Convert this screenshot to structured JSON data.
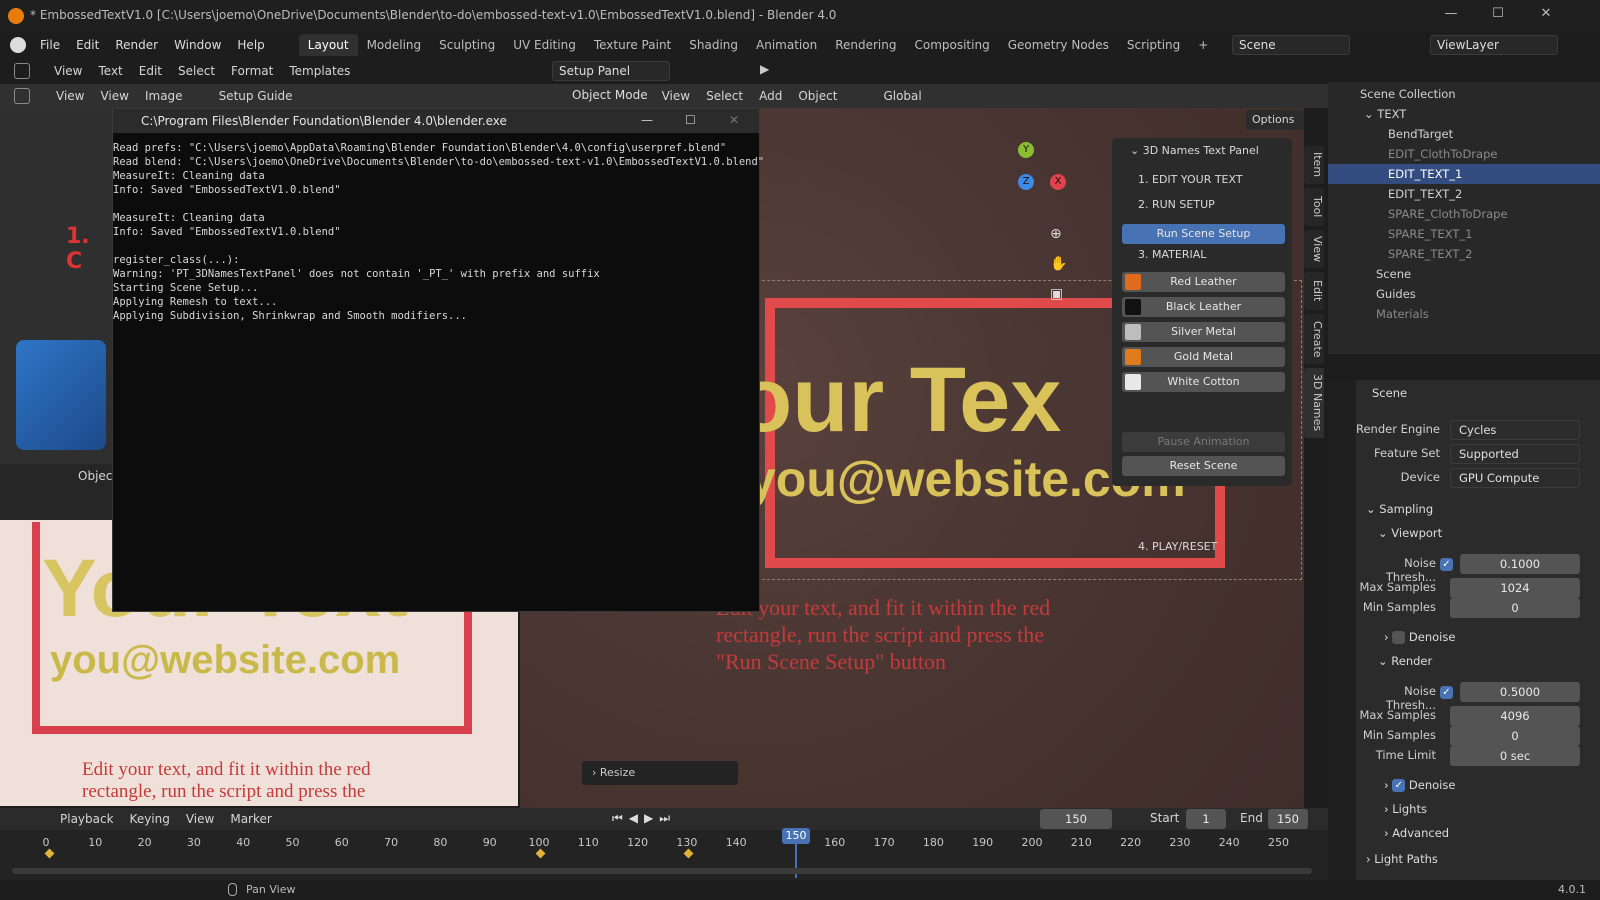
{
  "window": {
    "title": "* EmbossedTextV1.0 [C:\\Users\\joemo\\OneDrive\\Documents\\Blender\\to-do\\embossed-text-v1.0\\EmbossedTextV1.0.blend] - Blender 4.0"
  },
  "menu": [
    "File",
    "Edit",
    "Render",
    "Window",
    "Help"
  ],
  "workspaces": [
    "Layout",
    "Modeling",
    "Sculpting",
    "UV Editing",
    "Texture Paint",
    "Shading",
    "Animation",
    "Rendering",
    "Compositing",
    "Geometry Nodes",
    "Scripting"
  ],
  "scene_field": "Scene",
  "viewlayer_field": "ViewLayer",
  "text_editor": {
    "menus": [
      "View",
      "Text",
      "Edit",
      "Select",
      "Format",
      "Templates"
    ],
    "file": "Setup Panel"
  },
  "image_editor": {
    "menus": [
      "View",
      "View",
      "Image"
    ],
    "image": "Setup Guide"
  },
  "viewport": {
    "mode": "Object Mode",
    "menus": [
      "View",
      "Select",
      "Add",
      "Object"
    ],
    "transform": "Global",
    "options": "Options",
    "resize": "Resize",
    "big_text": "our Tex",
    "email": "you@website.com",
    "instructions": [
      "Edit your text, and fit it within the red",
      "rectangle, run the script and press the",
      "\"Run Scene Setup\" button"
    ],
    "gizmo": {
      "y": "Y",
      "z": "Z",
      "x": "X"
    }
  },
  "side_tabs": [
    "Item",
    "Tool",
    "View",
    "Edit",
    "Create",
    "3D Names"
  ],
  "console": {
    "title": "C:\\Program Files\\Blender Foundation\\Blender 4.0\\blender.exe",
    "text": "Read prefs: \"C:\\Users\\joemo\\AppData\\Roaming\\Blender Foundation\\Blender\\4.0\\config\\userpref.blend\"\nRead blend: \"C:\\Users\\joemo\\OneDrive\\Documents\\Blender\\to-do\\embossed-text-v1.0\\EmbossedTextV1.0.blend\"\nMeasureIt: Cleaning data\nInfo: Saved \"EmbossedTextV1.0.blend\"\n\nMeasureIt: Cleaning data\nInfo: Saved \"EmbossedTextV1.0.blend\"\n\nregister_class(...):\nWarning: 'PT_3DNamesTextPanel' does not contain '_PT_' with prefix and suffix\nStarting Scene Setup...\nApplying Remesh to text...\nApplying Subdivision, Shrinkwrap and Smooth modifiers..."
  },
  "npanel": {
    "title": "3D Names Text Panel",
    "s1": "1. EDIT YOUR TEXT",
    "s2": "2. RUN SETUP",
    "run": "Run Scene Setup",
    "s3": "3. MATERIAL",
    "materials": [
      {
        "label": "Red Leather",
        "color": "#e06a1e"
      },
      {
        "label": "Black Leather",
        "color": "#111111"
      },
      {
        "label": "Silver Metal",
        "color": "#bdbdbd"
      },
      {
        "label": "Gold Metal",
        "color": "#e07b1e"
      },
      {
        "label": "White Cotton",
        "color": "#e8e8e8"
      }
    ],
    "s4": "4. PLAY/RESET",
    "pause": "Pause Animation",
    "reset": "Reset Scene"
  },
  "outliner": {
    "root": "Scene Collection",
    "rows": [
      "TEXT",
      "BendTarget",
      "EDIT_ClothToDrape",
      "EDIT_TEXT_1",
      "EDIT_TEXT_2",
      "SPARE_ClothToDrape",
      "SPARE_TEXT_1",
      "SPARE_TEXT_2",
      "Scene",
      "Guides",
      "Materials"
    ]
  },
  "props": {
    "scene": "Scene",
    "render_engine_label": "Render Engine",
    "render_engine": "Cycles",
    "feature_set_label": "Feature Set",
    "feature_set": "Supported",
    "device_label": "Device",
    "device": "GPU Compute",
    "sampling": "Sampling",
    "viewport": "Viewport",
    "noise_label": "Noise Thresh...",
    "v_noise": "0.1000",
    "max_label": "Max Samples",
    "v_max": "1024",
    "min_label": "Min Samples",
    "v_min": "0",
    "denoise": "Denoise",
    "render": "Render",
    "r_noise": "0.5000",
    "r_max": "4096",
    "r_min": "0",
    "time_label": "Time Limit",
    "time": "0 sec",
    "lights": "Lights",
    "advanced": "Advanced",
    "light_paths": "Light Paths"
  },
  "timeline": {
    "menus": [
      "Playback",
      "Keying",
      "View",
      "Marker"
    ],
    "current": "150",
    "start_label": "Start",
    "start": "1",
    "end_label": "End",
    "end": "150",
    "ticks": [
      "0",
      "10",
      "20",
      "30",
      "40",
      "50",
      "60",
      "70",
      "80",
      "90",
      "100",
      "110",
      "120",
      "130",
      "140",
      "150",
      "160",
      "170",
      "180",
      "190",
      "200",
      "210",
      "220",
      "230",
      "240",
      "250"
    ]
  },
  "left_image": {
    "text1": "Your Text",
    "email": "you@website.com",
    "instr": [
      "Edit your text, and fit it within the red",
      "rectangle, run the script and press the"
    ],
    "mode": "Object",
    "overlay": "1. C"
  },
  "status": {
    "pan": "Pan View",
    "version": "4.0.1"
  }
}
